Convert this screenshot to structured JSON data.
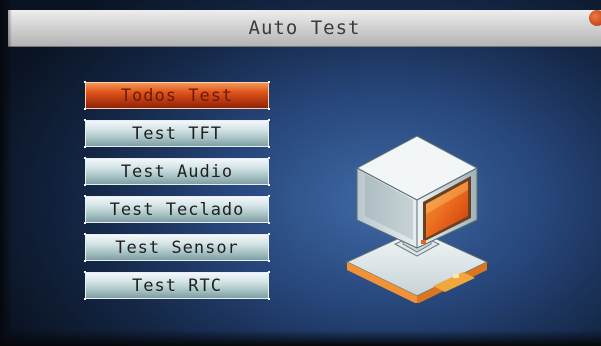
{
  "window": {
    "title": "Auto Test"
  },
  "menu": {
    "items": [
      {
        "label": "Todos Test",
        "selected": true
      },
      {
        "label": "Test TFT",
        "selected": false
      },
      {
        "label": "Test Audio",
        "selected": false
      },
      {
        "label": "Test Teclado",
        "selected": false
      },
      {
        "label": "Test Sensor",
        "selected": false
      },
      {
        "label": "Test RTC",
        "selected": false
      }
    ]
  },
  "colors": {
    "background": "#27467b",
    "title_bar": "#d3d3d3",
    "selected_item": "#e2571f",
    "menu_item": "#d4e4e6"
  },
  "icons": {
    "illustration": "computer-monitor-icon",
    "corner": "status-indicator-icon"
  }
}
